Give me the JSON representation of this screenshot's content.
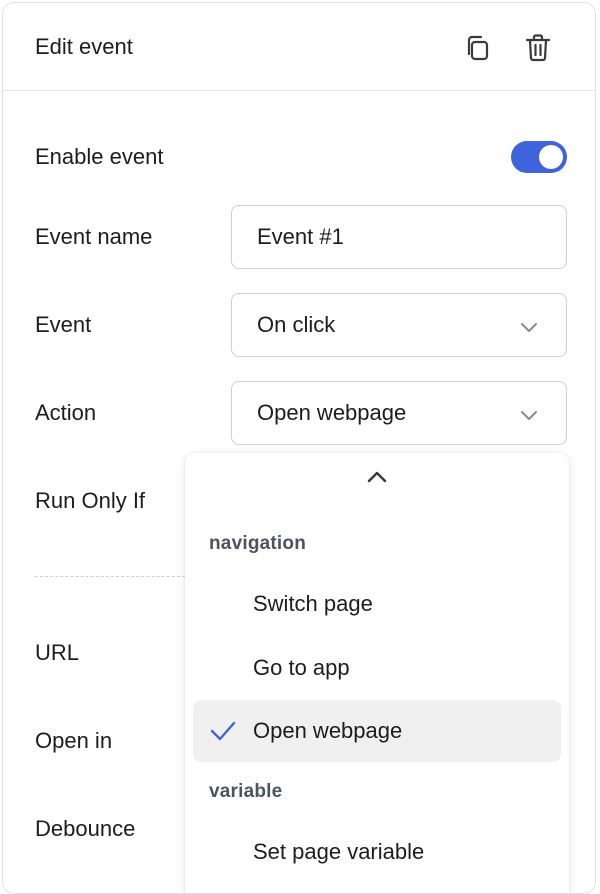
{
  "header": {
    "title": "Edit event",
    "icons": [
      "copy-icon",
      "trash-icon"
    ]
  },
  "form": {
    "enable_event": {
      "label": "Enable event",
      "value": true,
      "accent_color": "#3e63dd"
    },
    "event_name": {
      "label": "Event name",
      "value": "Event #1"
    },
    "event": {
      "label": "Event",
      "value": "On click"
    },
    "action": {
      "label": "Action",
      "value": "Open webpage"
    },
    "run_only_if": {
      "label": "Run Only If"
    },
    "url": {
      "label": "URL"
    },
    "open_in": {
      "label": "Open in"
    },
    "debounce": {
      "label": "Debounce"
    }
  },
  "dropdown": {
    "groups": [
      {
        "label": "navigation",
        "options": [
          {
            "label": "Switch page",
            "selected": false
          },
          {
            "label": "Go to app",
            "selected": false
          },
          {
            "label": "Open webpage",
            "selected": true
          }
        ]
      },
      {
        "label": "variable",
        "options": [
          {
            "label": "Set page variable",
            "selected": false
          }
        ]
      }
    ],
    "check_color": "#3e63dd"
  }
}
